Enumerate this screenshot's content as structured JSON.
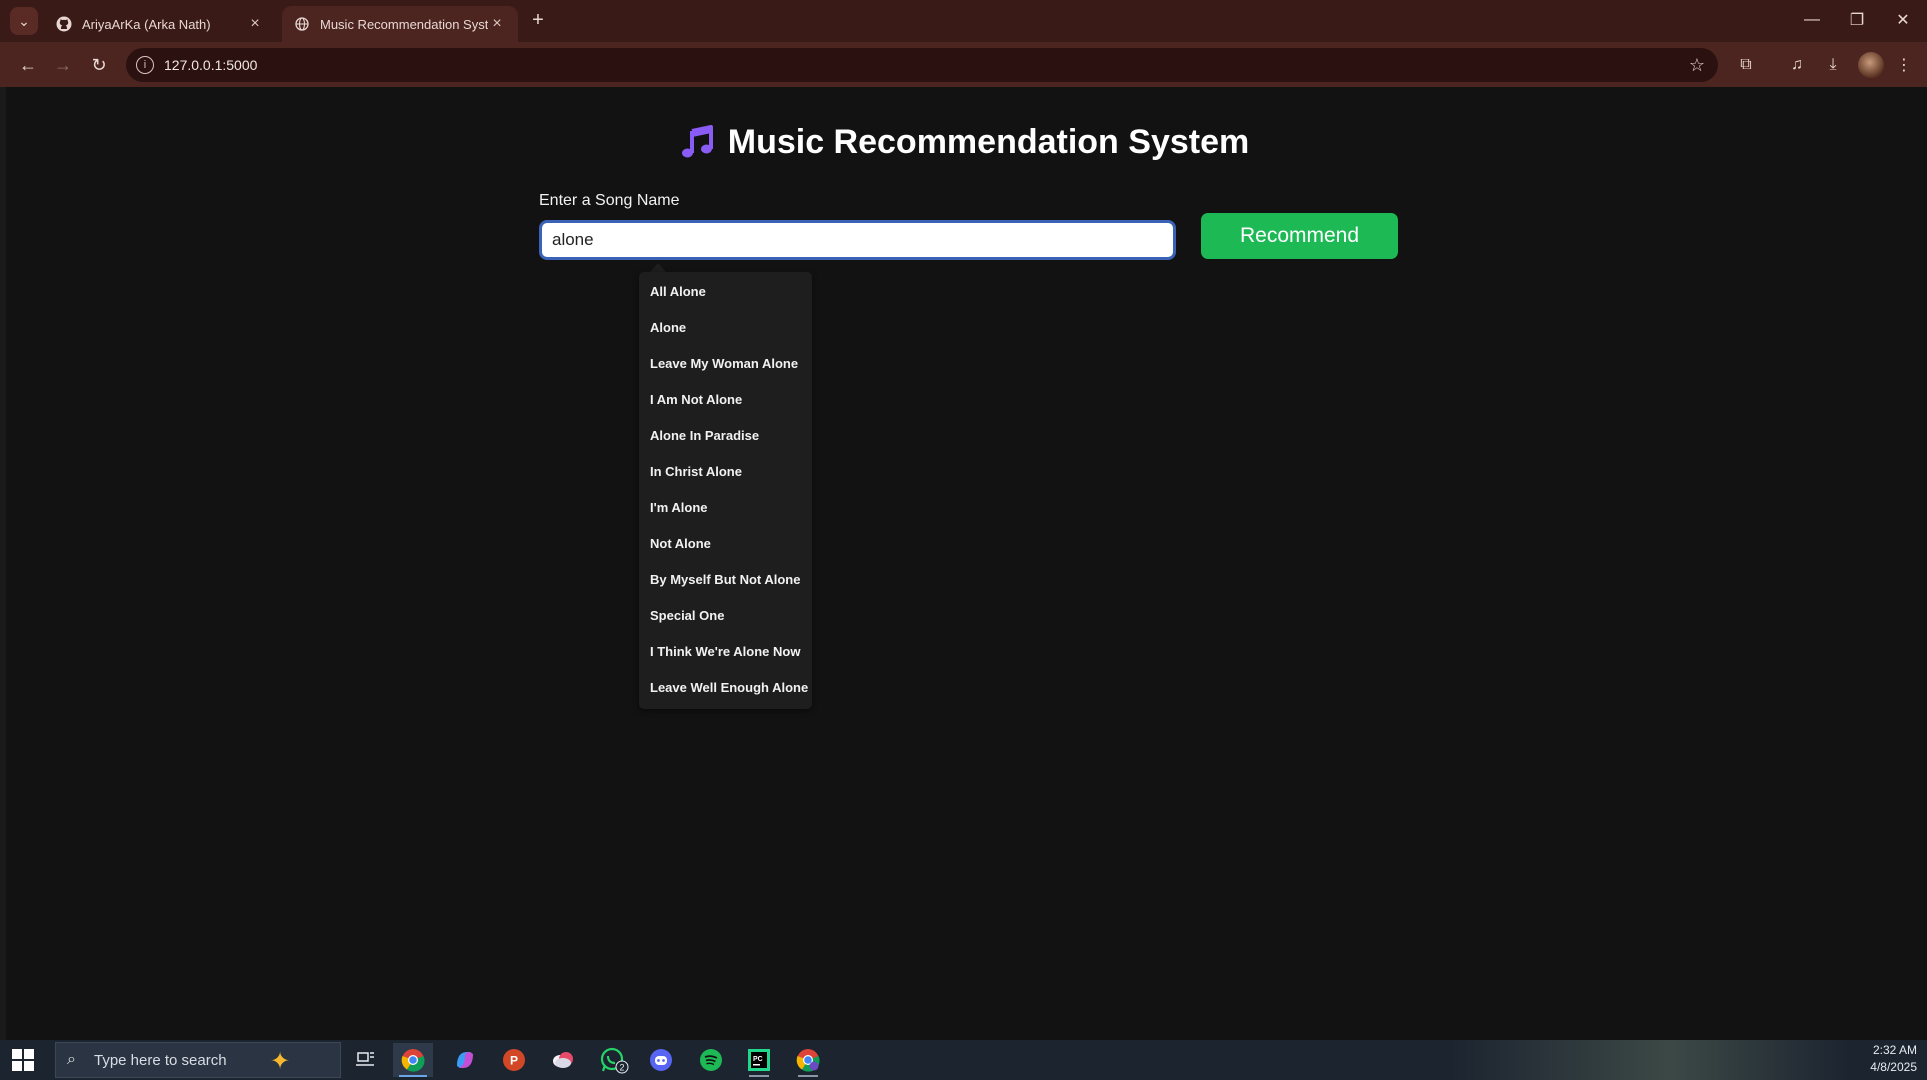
{
  "browser": {
    "tabs": [
      {
        "title": "AriyaArKa (Arka Nath)",
        "active": false
      },
      {
        "title": "Music Recommendation System",
        "active": true
      }
    ],
    "url": "127.0.0.1:5000"
  },
  "page": {
    "title": "Music Recommendation System",
    "input_label": "Enter a Song Name",
    "input_value": "alone",
    "button_label": "Recommend",
    "suggestions": [
      "All Alone",
      "Alone",
      "Leave My Woman Alone",
      "I Am Not Alone",
      "Alone In Paradise",
      "In Christ Alone",
      "I'm Alone",
      "Not Alone",
      "By Myself But Not Alone",
      "Special One",
      "I Think We're Alone Now",
      "Leave Well Enough Alone"
    ]
  },
  "taskbar": {
    "search_placeholder": "Type here to search",
    "whatsapp_badge": "2",
    "time": "2:32 AM",
    "date": "4/8/2025"
  },
  "colors": {
    "accent_green": "#1db954",
    "page_background": "#121212",
    "input_focus_border": "#3a63b8",
    "icon_purple": "#8a5cf6"
  }
}
